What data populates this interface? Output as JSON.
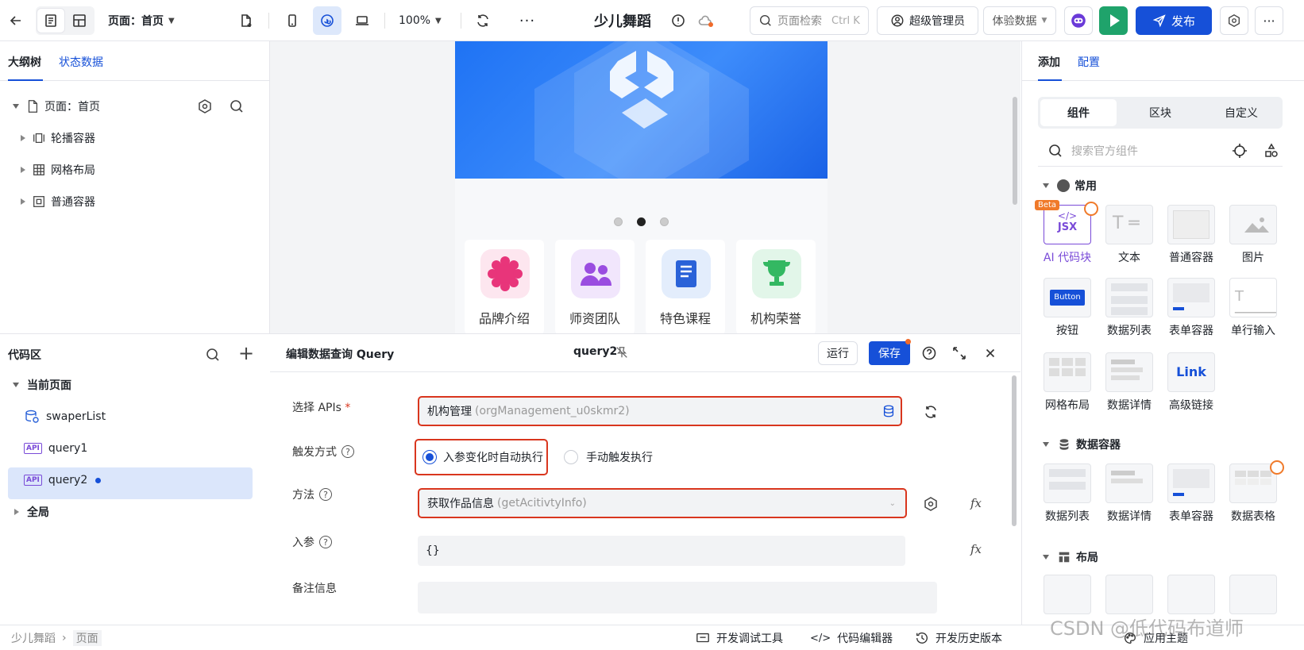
{
  "topbar": {
    "page_selector": "页面：首页",
    "zoom": "100%",
    "app_title": "少儿舞蹈",
    "search_placeholder": "页面检索",
    "search_shortcut": "Ctrl K",
    "user": "超级管理员",
    "data_mode": "体验数据",
    "publish": "发布"
  },
  "outline": {
    "tab_outline": "大纲树",
    "tab_state": "状态数据",
    "root": "页面：首页",
    "items": [
      "轮播容器",
      "网格布局",
      "普通容器"
    ]
  },
  "code_area": {
    "title": "代码区",
    "current_page": "当前页面",
    "items": [
      "swaperList",
      "query1",
      "query2"
    ],
    "api_badge": "API",
    "global": "全局"
  },
  "canvas": {
    "features": [
      {
        "label": "品牌介绍",
        "color": "#e8357a",
        "bg": "#fde6ef"
      },
      {
        "label": "师资团队",
        "color": "#9a4de0",
        "bg": "#f1e6fc"
      },
      {
        "label": "特色课程",
        "color": "#2a62d8",
        "bg": "#e3edfc"
      },
      {
        "label": "机构荣誉",
        "color": "#33b862",
        "bg": "#e2f6e9"
      }
    ]
  },
  "editor": {
    "title": "编辑数据查询 Query",
    "query_name": "query2",
    "run": "运行",
    "save": "保存",
    "api_label": "选择 APIs",
    "required_mark": "*",
    "api_value": "机构管理",
    "api_value_sub": "(orgManagement_u0skmr2)",
    "trigger_label": "触发方式",
    "trigger_auto": "入参变化时自动执行",
    "trigger_manual": "手动触发执行",
    "method_label": "方法",
    "method_value": "获取作品信息",
    "method_value_sub": "(getAcitivtyInfo)",
    "params_label": "入参",
    "params_value": "{}",
    "remark_label": "备注信息",
    "help_glyph": "?",
    "fx": "fx"
  },
  "right_panel": {
    "tab_add": "添加",
    "tab_config": "配置",
    "seg_components": "组件",
    "seg_blocks": "区块",
    "seg_custom": "自定义",
    "search_placeholder": "搜索官方组件",
    "section_common": "常用",
    "section_data": "数据容器",
    "section_layout": "布局",
    "beta": "Beta",
    "jsx": "JSX",
    "button_thumb": "Button",
    "link_thumb": "Link",
    "common_items": [
      "AI 代码块",
      "文本",
      "普通容器",
      "图片",
      "按钮",
      "数据列表",
      "表单容器",
      "单行输入",
      "网格布局",
      "数据详情",
      "高级链接"
    ],
    "data_items": [
      "数据列表",
      "数据详情",
      "表单容器",
      "数据表格"
    ]
  },
  "statusbar": {
    "crumb_app": "少儿舞蹈",
    "crumb_page": "页面",
    "dev_tools": "开发调试工具",
    "code_editor": "代码编辑器",
    "history": "开发历史版本",
    "theme": "应用主题",
    "watermark": "CSDN @低代码布道师"
  },
  "colors": {
    "primary": "#1650d8",
    "highlight": "#d9361e",
    "run_green": "#1fa36b"
  }
}
